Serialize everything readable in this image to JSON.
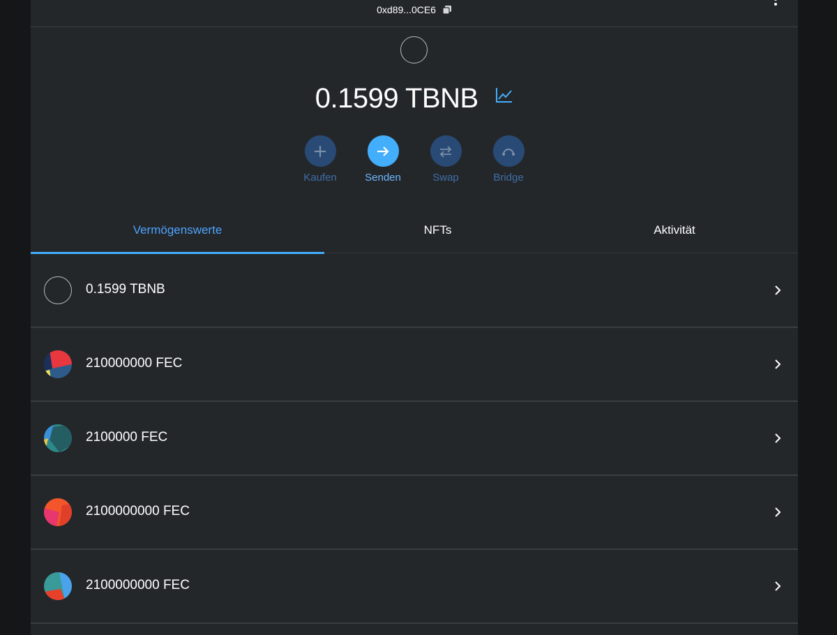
{
  "header": {
    "address": "0xd89...0CE6"
  },
  "balance": {
    "amount": "0.1599",
    "symbol": "TBNB"
  },
  "actions": [
    {
      "label": "Kaufen",
      "icon": "plus-icon"
    },
    {
      "label": "Senden",
      "icon": "arrow-right-icon"
    },
    {
      "label": "Swap",
      "icon": "swap-arrows-icon"
    },
    {
      "label": "Bridge",
      "icon": "bridge-icon"
    }
  ],
  "tabs": [
    {
      "label": "Vermögenswerte",
      "active": true
    },
    {
      "label": "NFTs",
      "active": false
    },
    {
      "label": "Aktivität",
      "active": false
    }
  ],
  "assets": [
    {
      "label": "0.1599 TBNB",
      "icon": "empty-token-icon"
    },
    {
      "label": "210000000 FEC",
      "icon": "identicon-red-blue"
    },
    {
      "label": "2100000 FEC",
      "icon": "identicon-teal-blue"
    },
    {
      "label": "2100000000 FEC",
      "icon": "identicon-orange-pink"
    },
    {
      "label": "2100000000 FEC",
      "icon": "identicon-teal-orange"
    }
  ],
  "colors": {
    "accent": "#43aefc",
    "background": "#24272a",
    "action_inactive": "#284a75"
  }
}
